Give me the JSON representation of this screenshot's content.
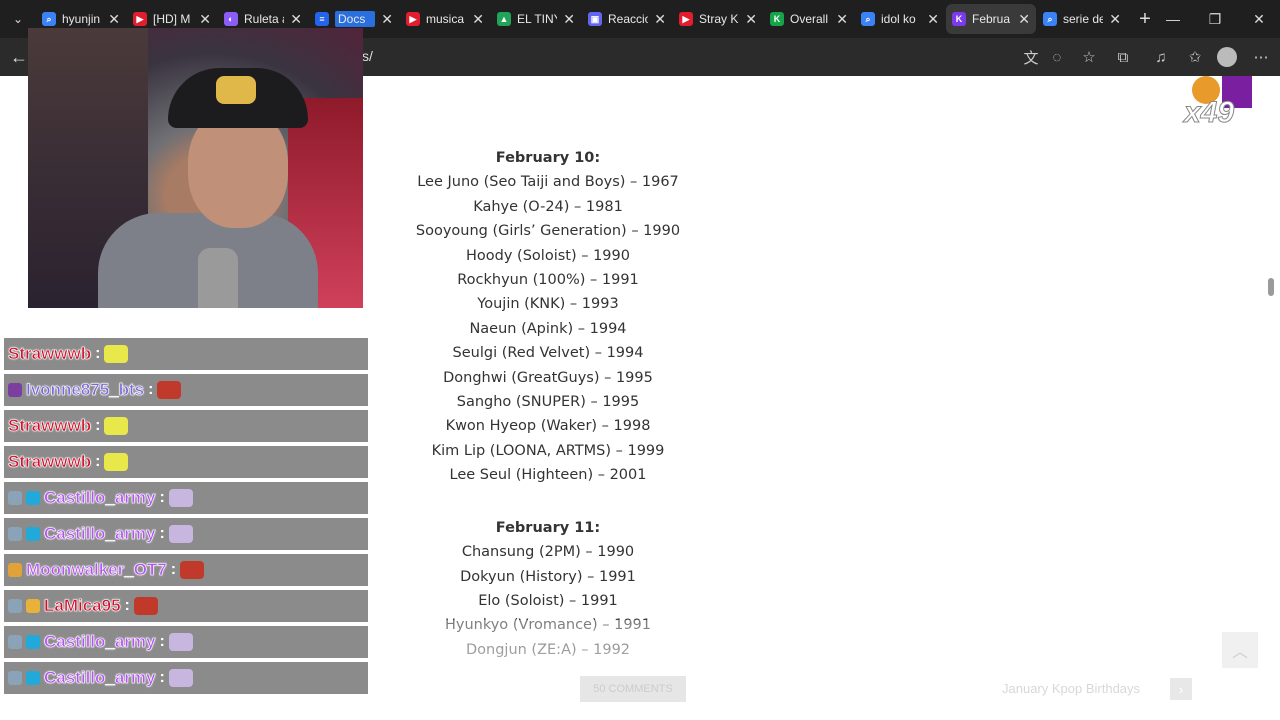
{
  "tabs": [
    {
      "title": "hyunjin",
      "fav_color": "#3b82f6",
      "fav_glyph": "⌕"
    },
    {
      "title": "[HD] M",
      "fav_color": "#e11d2e",
      "fav_glyph": "▶"
    },
    {
      "title": "Ruleta a",
      "fav_color": "#8b5cf6",
      "fav_glyph": "◐"
    },
    {
      "title": "Docs",
      "fav_color": "#2563eb",
      "fav_glyph": "≡",
      "active_style": "docs"
    },
    {
      "title": "musica",
      "fav_color": "#e11d2e",
      "fav_glyph": "▶"
    },
    {
      "title": "EL TINY",
      "fav_color": "#22a35a",
      "fav_glyph": "▲"
    },
    {
      "title": "Reaccio",
      "fav_color": "#6366f1",
      "fav_glyph": "▣"
    },
    {
      "title": "Stray Ki",
      "fav_color": "#e11d2e",
      "fav_glyph": "▶"
    },
    {
      "title": "Overall",
      "fav_color": "#16a34a",
      "fav_glyph": "K"
    },
    {
      "title": "idol ko",
      "fav_color": "#3b82f6",
      "fav_glyph": "⌕"
    },
    {
      "title": "Februa",
      "fav_color": "#7c3aed",
      "fav_glyph": "K",
      "active": true
    },
    {
      "title": "serie de",
      "fav_color": "#3b82f6",
      "fav_glyph": "⌕"
    }
  ],
  "address": {
    "url_visible": "s/"
  },
  "article": {
    "sections": [
      {
        "heading": "February 10:",
        "lines": [
          "Lee Juno (Seo Taiji and Boys) – 1967",
          "Kahye (O-24) – 1981",
          "Sooyoung (Girls’ Generation) – 1990",
          "Hoody (Soloist) – 1990",
          "Rockhyun (100%) – 1991",
          "Youjin (KNK) – 1993",
          "Naeun (Apink) – 1994",
          "Seulgi (Red Velvet) – 1994",
          "Donghwi (GreatGuys) – 1995",
          "Sangho (SNUPER) – 1995",
          "Kwon Hyeop (Waker) – 1998",
          "Kim Lip (LOONA, ARTMS) – 1999",
          "Lee Seul (Highteen) – 2001"
        ]
      },
      {
        "heading": "February 11:",
        "lines": [
          "Chansung (2PM) – 1990",
          "Dokyun (History) – 1991",
          "Elo (Soloist) – 1991",
          "Hyunkyo (Vromance) – 1991",
          "Dongjun (ZE:A) – 1992"
        ]
      }
    ],
    "comments_button": "50 COMMENTS",
    "next_post": "January Kpop Birthdays"
  },
  "chat": [
    {
      "user": "Strawwwb",
      "color": "#d0102b",
      "emote_color": "#e8e84a",
      "badges": []
    },
    {
      "user": "Ivonne875_bts",
      "color": "#7c66d8",
      "emote_color": "#c0392b",
      "badges": [
        "#7b3fa0"
      ]
    },
    {
      "user": "Strawwwb",
      "color": "#d0102b",
      "emote_color": "#e8e84a",
      "badges": []
    },
    {
      "user": "Strawwwb",
      "color": "#d0102b",
      "emote_color": "#e8e84a",
      "badges": []
    },
    {
      "user": "Castillo_army",
      "color": "#b455f0",
      "emote_color": "#c9b6e0",
      "badges": [
        "#8aa3b8",
        "#21a9d9"
      ]
    },
    {
      "user": "Castillo_army",
      "color": "#b455f0",
      "emote_color": "#c9b6e0",
      "badges": [
        "#8aa3b8",
        "#21a9d9"
      ]
    },
    {
      "user": "Moonwalker_OT7",
      "color": "#b455f0",
      "emote_color": "#c0392b",
      "badges": [
        "#e2a23a"
      ]
    },
    {
      "user": "LaMica95",
      "color": "#d0102b",
      "emote_color": "#c0392b",
      "badges": [
        "#8aa3b8",
        "#e8b23a"
      ]
    },
    {
      "user": "Castillo_army",
      "color": "#b455f0",
      "emote_color": "#c9b6e0",
      "badges": [
        "#8aa3b8",
        "#21a9d9"
      ]
    },
    {
      "user": "Castillo_army",
      "color": "#b455f0",
      "emote_color": "#c9b6e0",
      "badges": [
        "#8aa3b8",
        "#21a9d9"
      ]
    }
  ],
  "chat_colon": ":",
  "combo": {
    "label": "x49"
  }
}
